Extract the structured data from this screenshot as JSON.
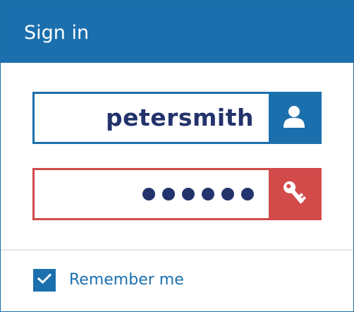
{
  "header": {
    "title": "Sign in"
  },
  "username": {
    "value": "petersmith",
    "icon": "user-icon"
  },
  "password": {
    "masked_length": 6,
    "icon": "key-icon"
  },
  "remember": {
    "label": "Remember me",
    "checked": true
  },
  "colors": {
    "brand_blue": "#1b6fad",
    "error_red": "#d24a4a",
    "text_navy": "#23336b"
  }
}
